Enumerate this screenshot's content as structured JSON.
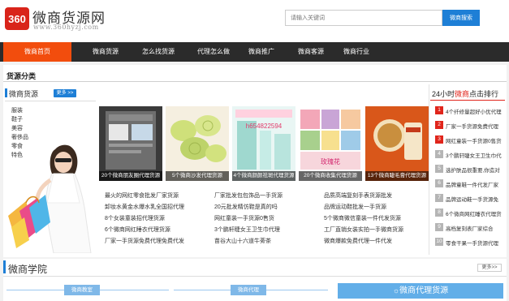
{
  "header": {
    "logo_badge": "360",
    "logo_title": "微商货源网",
    "logo_url": "www.360hyzj.com",
    "search": {
      "placeholder": "请输入关键词",
      "button": "微商搜索"
    }
  },
  "nav": {
    "items": [
      {
        "label": "微商首页",
        "active": true
      },
      {
        "label": "微商货源",
        "active": false
      },
      {
        "label": "怎么找货源",
        "active": false
      },
      {
        "label": "代理怎么做",
        "active": false
      },
      {
        "label": "微商推广",
        "active": false
      },
      {
        "label": "微商客源",
        "active": false
      },
      {
        "label": "微商行业",
        "active": false
      }
    ]
  },
  "source_section": {
    "title": "货源分类",
    "sub_title": "微商货源",
    "more": "更多 >>",
    "categories": [
      "服装",
      "鞋子",
      "美容",
      "奢侈品",
      "零食",
      "特色"
    ],
    "thumbs": [
      {
        "caption": "20个微商朋友圈代理货源"
      },
      {
        "caption": "5个微商沙发代理货源"
      },
      {
        "caption": "4个微商颜颜祛斑代理货源"
      },
      {
        "caption": "20个微商收集代理货源"
      },
      {
        "caption": "13个微商睫毛膏代理货源"
      }
    ],
    "thumb_texts": {
      "flowers_word": "玫瑰花",
      "phone": "h654822594"
    },
    "links": [
      [
        "最火的网红零食批发厂家货源",
        "厂家批发包包饰品一手货源",
        "品质高端复刻手表货源批发"
      ],
      [
        "卸妆水黄金水爆水乳全国招代理",
        "20元批发精仿鞋是真的吗",
        "品牌运动鞋批发一手货源"
      ],
      [
        "8个女装童装招代理货源",
        "网红童装一手货源0售货",
        "5个微商微信童装一件代发货源"
      ],
      [
        "6个微商网红睡衣代理货源",
        "3个鹏轩睫女王卫生巾代理",
        "工厂直销女装实拍一手微商货源"
      ],
      [
        "厂家一手货源免费代理免费代发",
        "苗谷大山十六道牛蒡茶",
        "微商爆款免费代理一件代发"
      ]
    ]
  },
  "ranking": {
    "title_prefix": "24小时",
    "title_highlight": "微商",
    "title_suffix": "点击排行",
    "items": [
      {
        "num": "1",
        "text": "4个纤修量超好小优代理"
      },
      {
        "num": "2",
        "text": "厂家一手货源免费代理"
      },
      {
        "num": "3",
        "text": "网红童装一手货源0售货"
      },
      {
        "num": "4",
        "text": "3个鹏轩睫女王卫生巾代"
      },
      {
        "num": "5",
        "text": "选护肤品很重要,你造对"
      },
      {
        "num": "6",
        "text": "品牌童鞋一件代发厂家"
      },
      {
        "num": "7",
        "text": "品牌运动鞋一手货源免"
      },
      {
        "num": "8",
        "text": "6个微商网红睡衣代理货"
      },
      {
        "num": "9",
        "text": "高档复刻表厂家综合"
      },
      {
        "num": "10",
        "text": "零食干果一手货源代理"
      }
    ]
  },
  "college": {
    "title": "微商学院",
    "more": "更多>>",
    "tags": [
      "微商教室",
      "微商代理",
      "微商代理货源"
    ]
  },
  "colors": {
    "accent_orange": "#f24d0d",
    "brand_red": "#d9241a",
    "link_blue": "#1e7fd6",
    "nav_dark": "#2b2b2b"
  }
}
